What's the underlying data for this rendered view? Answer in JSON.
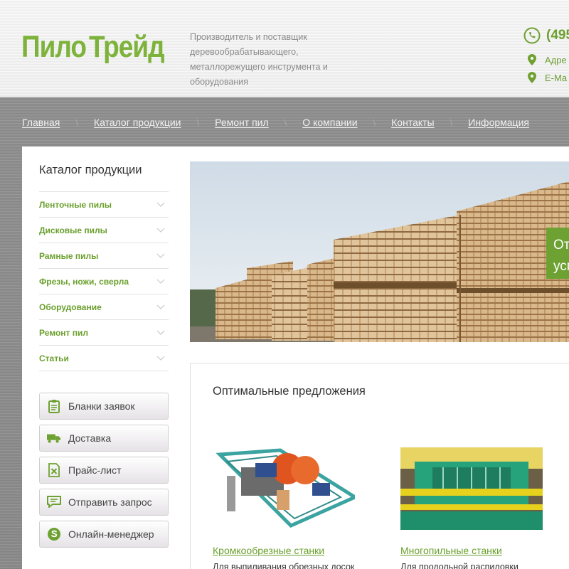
{
  "brand": {
    "logo_left": "Пило",
    "logo_right": "Трейд",
    "tagline": "Производитель и поставщик деревообрабатывающего, металлорежущего инструмента и оборудования"
  },
  "contacts": {
    "phone": "(495",
    "address_label": "Адре",
    "email_label": "E-Ma"
  },
  "nav": {
    "items": [
      "Главная",
      "Каталог продукции",
      "Ремонт пил",
      "О компании",
      "Контакты",
      "Информация"
    ],
    "separator": "\\"
  },
  "sidebar": {
    "title": "Каталог продукции",
    "categories": [
      "Ленточные пилы",
      "Дисковые пилы",
      "Рамные пилы",
      "Фрезы, ножи, сверла",
      "Оборудование",
      "Ремонт пил",
      "Статьи"
    ],
    "buttons": [
      {
        "label": "Бланки заявок",
        "icon": "clipboard-icon"
      },
      {
        "label": "Доставка",
        "icon": "truck-icon"
      },
      {
        "label": "Прайс-лист",
        "icon": "excel-file-icon"
      },
      {
        "label": "Отправить запрос",
        "icon": "chat-icon"
      },
      {
        "label": "Онлайн-менеджер",
        "icon": "skype-icon"
      }
    ]
  },
  "hero": {
    "badge_line1": "От",
    "badge_line2": "усп"
  },
  "offers": {
    "title": "Оптимальные предложения",
    "products": [
      {
        "name": "Кромкообрезные станки",
        "desc": "Для выпиливания обрезных досок"
      },
      {
        "name": "Многопильные станки",
        "desc": "Для продольной распиловки"
      }
    ]
  },
  "colors": {
    "accent_green": "#6da232",
    "nav_text": "#f2f2f2",
    "page_bg": "#8c8c8c"
  }
}
